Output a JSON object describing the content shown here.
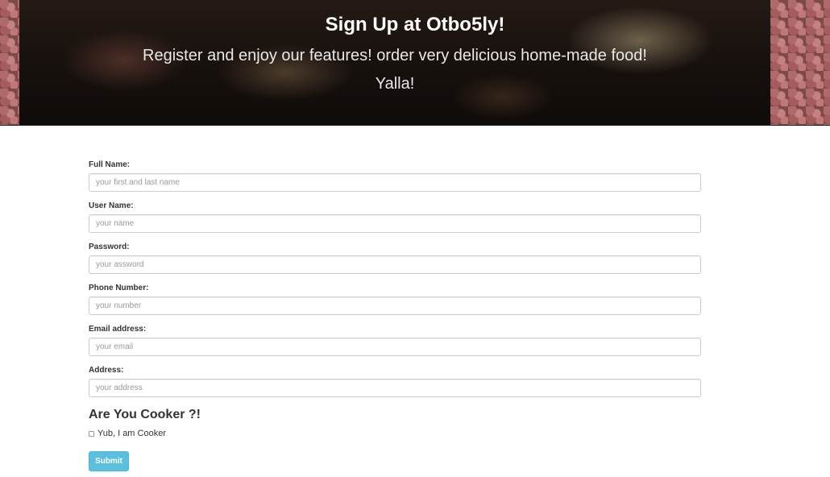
{
  "hero": {
    "title": "Sign Up at Otbo5ly!",
    "subtitle": "Register and enjoy our features! order very delicious home-made food!",
    "tagline": "Yalla!"
  },
  "form": {
    "fields": [
      {
        "label": "Full Name:",
        "placeholder": "your first and last name"
      },
      {
        "label": "User Name:",
        "placeholder": "your name"
      },
      {
        "label": "Password:",
        "placeholder": "your assword"
      },
      {
        "label": "Phone Number:",
        "placeholder": "your number"
      },
      {
        "label": "Email address:",
        "placeholder": "your email"
      },
      {
        "label": "Address:",
        "placeholder": "your address"
      }
    ],
    "cooker_heading": "Are You Cooker ?!",
    "cooker_checkbox_label": "Yub, I am Cooker",
    "submit_label": "Submit"
  },
  "colors": {
    "submit_bg": "#5bc0de",
    "hero_bg": "#2a1e18"
  }
}
